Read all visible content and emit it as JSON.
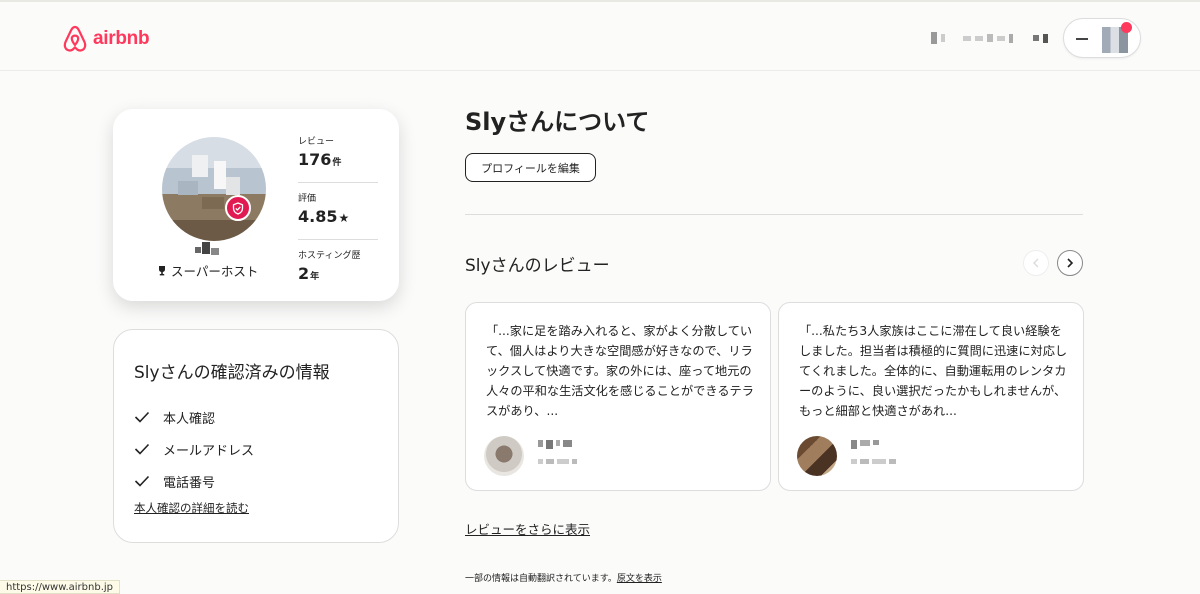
{
  "brand": {
    "name": "airbnb",
    "color": "#ff385c"
  },
  "header": {
    "user_menu_icon": "hamburger-icon",
    "avatar": "user-avatar"
  },
  "profile": {
    "badge_icon": "shield-check-icon",
    "superhost_label": "スーパーホスト",
    "stats": [
      {
        "label": "レビュー",
        "value": "176",
        "unit": "件"
      },
      {
        "label": "評価",
        "value": "4.85",
        "unit": "★"
      },
      {
        "label": "ホスティング歴",
        "value": "2",
        "unit": "年"
      }
    ]
  },
  "verified": {
    "title": "Slyさんの確認済みの情報",
    "items": [
      "本人確認",
      "メールアドレス",
      "電話番号"
    ],
    "link": "本人確認の詳細を読む"
  },
  "about": {
    "title": "Slyさんについて",
    "edit_button": "プロフィールを編集"
  },
  "reviews": {
    "title": "Slyさんのレビュー",
    "cards": [
      {
        "text": "「...家に足を踏み入れると、家がよく分散していて、個人はより大きな空間感が好きなので、リラックスして快適です。家の外には、座って地元の人々の平和な生活文化を感じることができるテラスがあり、..."
      },
      {
        "text": "「...私たち3人家族はここに滞在して良い経験をしました。担当者は積極的に質問に迅速に対応してくれました。全体的に、自動運転用のレンタカーのように、良い選択だったかもしれませんが、もっと細部と快適さがあれ..."
      }
    ],
    "more_link": "レビューをさらに表示"
  },
  "translation_note": {
    "text": "一部の情報は自動翻訳されています。",
    "link": "原文を表示"
  },
  "status_bar": {
    "url": "https://www.airbnb.jp"
  }
}
